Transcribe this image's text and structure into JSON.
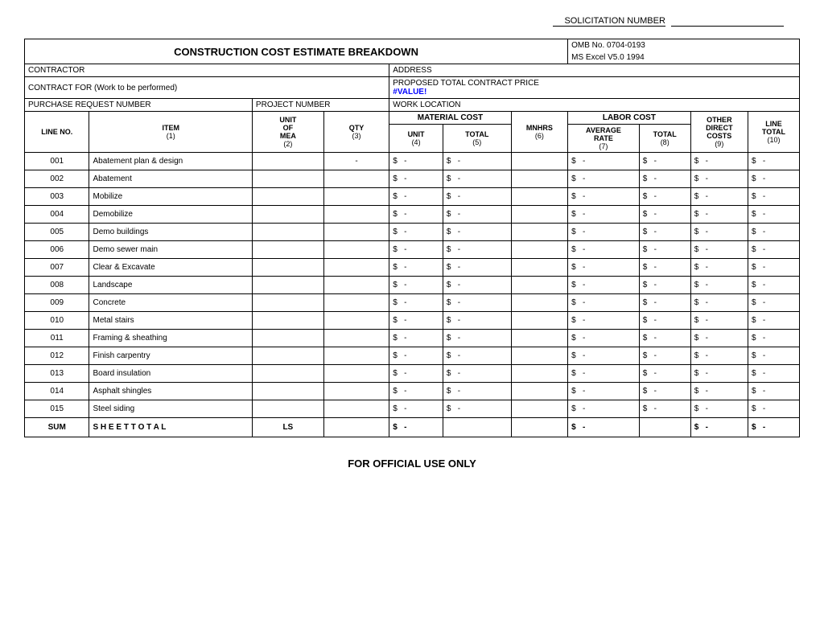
{
  "solicitation": {
    "label": "SOLICITATION NUMBER"
  },
  "header": {
    "title": "CONSTRUCTION COST ESTIMATE BREAKDOWN",
    "omb": "OMB No. 0704-0193",
    "excel": "MS Excel V5.0 1994"
  },
  "fields": {
    "contractor": "CONTRACTOR",
    "address": "ADDRESS",
    "contract_for": "CONTRACT FOR (Work to be performed)",
    "proposed_total": "PROPOSED TOTAL CONTRACT PRICE",
    "value_error": "#VALUE!",
    "purchase_request": "PURCHASE REQUEST NUMBER",
    "project_number": "PROJECT NUMBER",
    "work_location": "WORK LOCATION"
  },
  "material_cost_label": "MATERIAL COST",
  "labor_cost_label": "LABOR COST",
  "columns": {
    "line_no": "LINE NO.",
    "item": "ITEM",
    "unit_of_mea": "UNIT OF MEA",
    "qty": "QTY",
    "unit": "UNIT",
    "total_5": "TOTAL",
    "mnhrs": "MNHRS",
    "avg_rate": "AVERAGE RATE",
    "total_8": "TOTAL",
    "other_direct": "OTHER DIRECT COSTS",
    "line_total": "LINE TOTAL",
    "num1": "(1)",
    "num2": "(2)",
    "num3": "(3)",
    "num4": "(4)",
    "num5": "(5)",
    "num6": "(6)",
    "num7": "(7)",
    "num8": "(8)",
    "num9": "(9)",
    "num10": "(10)"
  },
  "rows": [
    {
      "no": "001",
      "item": "Abatement plan & design"
    },
    {
      "no": "002",
      "item": "Abatement"
    },
    {
      "no": "003",
      "item": "Mobilize"
    },
    {
      "no": "004",
      "item": "Demobilize"
    },
    {
      "no": "005",
      "item": "Demo buildings"
    },
    {
      "no": "006",
      "item": "Demo sewer main"
    },
    {
      "no": "007",
      "item": "Clear & Excavate"
    },
    {
      "no": "008",
      "item": "Landscape"
    },
    {
      "no": "009",
      "item": "Concrete"
    },
    {
      "no": "010",
      "item": "Metal stairs"
    },
    {
      "no": "011",
      "item": "Framing & sheathing"
    },
    {
      "no": "012",
      "item": "Finish carpentry"
    },
    {
      "no": "013",
      "item": "Board insulation"
    },
    {
      "no": "014",
      "item": "Asphalt shingles"
    },
    {
      "no": "015",
      "item": "Steel siding"
    }
  ],
  "sum_row": {
    "label": "SUM",
    "item": "S H E E T  T O T A L",
    "unit": "LS"
  },
  "footer": "FOR OFFICIAL USE ONLY",
  "dash": "-"
}
